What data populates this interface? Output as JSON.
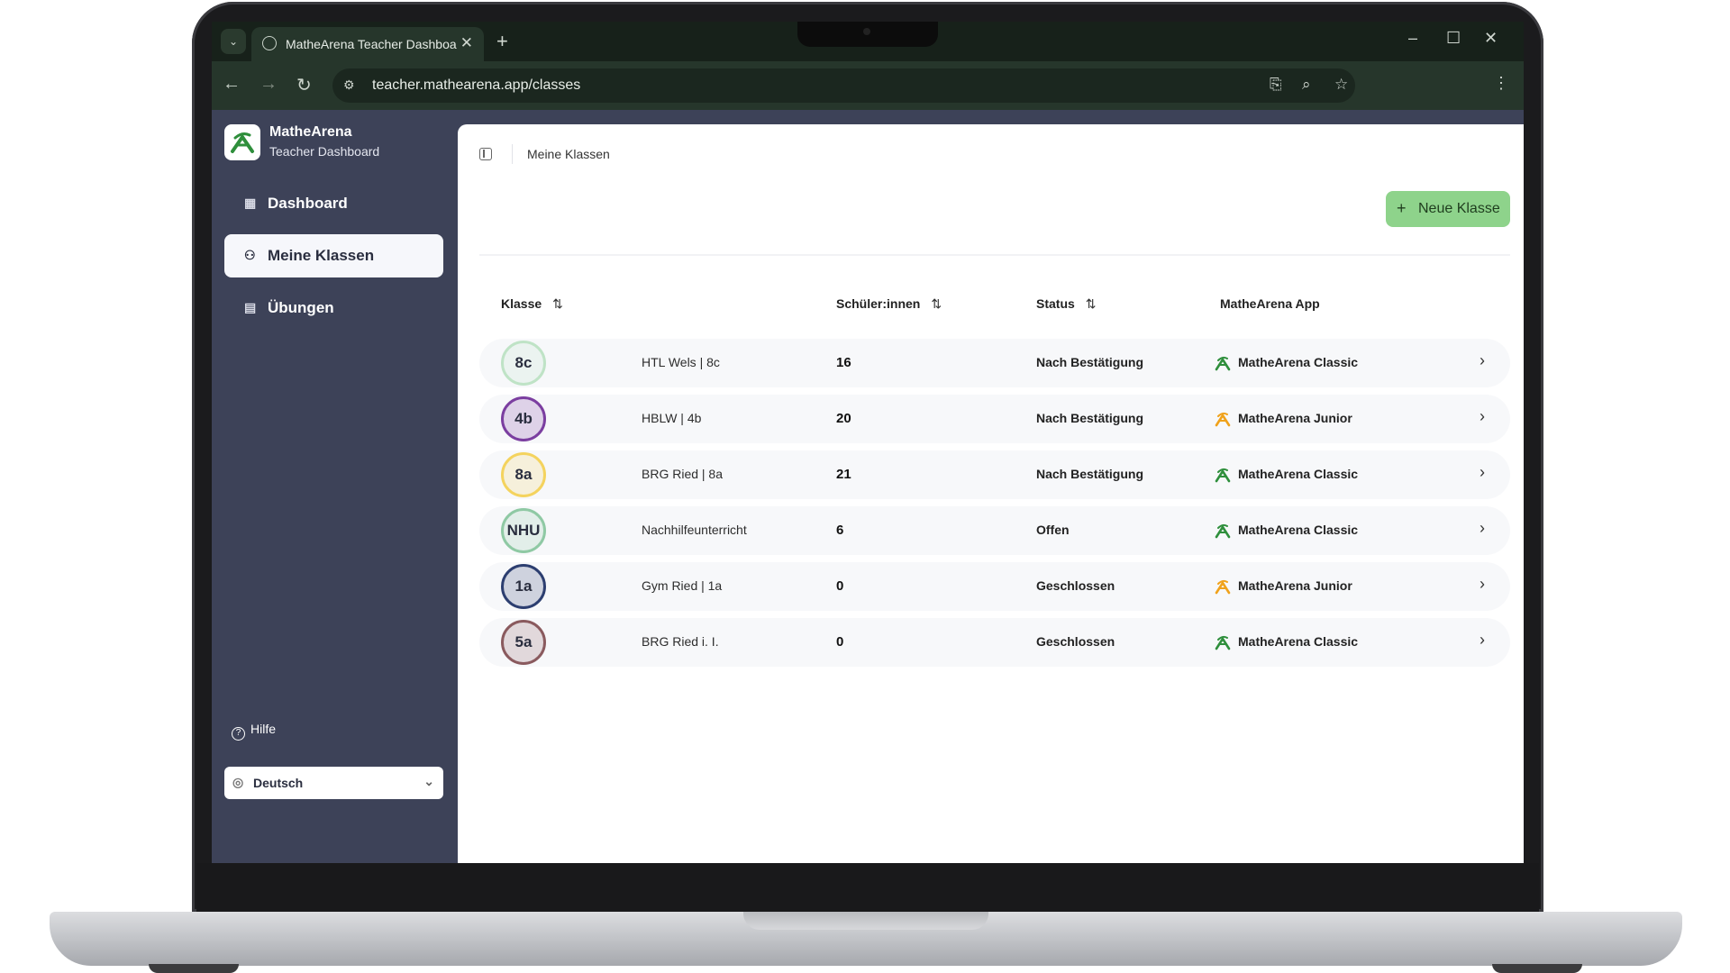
{
  "browser": {
    "tab_title": "MatheArena Teacher Dashboard",
    "url": "teacher.mathearena.app/classes",
    "new_tab_glyph": "+",
    "close_glyph": "✕"
  },
  "app": {
    "name": "MatheArena",
    "subtitle": "Teacher Dashboard"
  },
  "sidebar": {
    "items": [
      {
        "label": "Dashboard",
        "icon": "grid-icon",
        "glyph": "▦"
      },
      {
        "label": "Meine Klassen",
        "icon": "users-icon",
        "glyph": "⚇"
      },
      {
        "label": "Übungen",
        "icon": "exercise-icon",
        "glyph": "▤"
      }
    ],
    "help_label": "Hilfe",
    "language": "Deutsch"
  },
  "main": {
    "breadcrumb": "Meine Klassen",
    "new_class_label": "Neue Klasse",
    "columns": [
      "Klasse",
      "Schüler:innen",
      "Status",
      "MatheArena App"
    ],
    "rows": [
      {
        "code": "8c",
        "name": "HTL Wels | 8c",
        "students": "16",
        "status": "Nach Bestätigung",
        "app": "MatheArena Classic",
        "app_type": "classic",
        "color": "#bfe3c6"
      },
      {
        "code": "4b",
        "name": "HBLW | 4b",
        "students": "20",
        "status": "Nach Bestätigung",
        "app": "MatheArena Junior",
        "app_type": "junior",
        "color": "#7b3ea0"
      },
      {
        "code": "8a",
        "name": "BRG Ried | 8a",
        "students": "21",
        "status": "Nach Bestätigung",
        "app": "MatheArena Classic",
        "app_type": "classic",
        "color": "#f4d35e"
      },
      {
        "code": "NHU",
        "name": "Nachhilfeunterricht",
        "students": "6",
        "status": "Offen",
        "app": "MatheArena Classic",
        "app_type": "classic",
        "color": "#8fc9a4"
      },
      {
        "code": "1a",
        "name": "Gym Ried | 1a",
        "students": "0",
        "status": "Geschlossen",
        "app": "MatheArena Junior",
        "app_type": "junior",
        "color": "#2c3e70"
      },
      {
        "code": "5a",
        "name": "BRG Ried i. I.",
        "students": "0",
        "status": "Geschlossen",
        "app": "MatheArena Classic",
        "app_type": "classic",
        "color": "#8a5a5e"
      }
    ]
  },
  "colors": {
    "sidebar_bg": "#3d4258",
    "accent_green": "#8ed38b",
    "classic_logo": "#2f8f3c",
    "junior_logo": "#f0a21b"
  }
}
